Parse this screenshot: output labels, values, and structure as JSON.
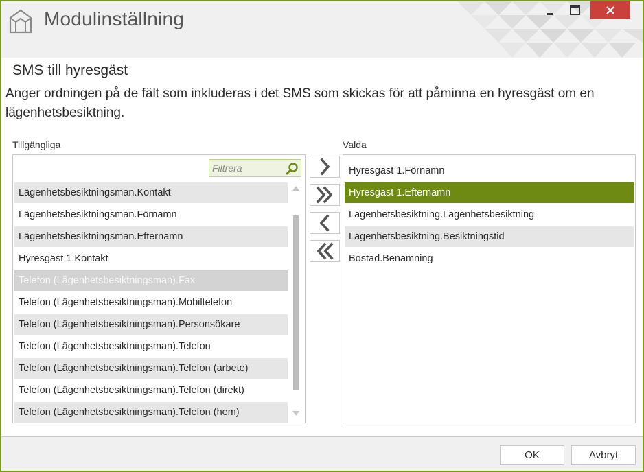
{
  "window": {
    "title": "Modulinställning"
  },
  "section": {
    "title": "SMS till hyresgäst",
    "description": "Anger ordningen på de fält som inkluderas i det SMS som skickas för att påminna en hyresgäst om en lägenhetsbesiktning."
  },
  "available": {
    "label": "Tillgängliga",
    "filter_placeholder": "Filtrera",
    "items": [
      "Lägenhetsbesiktningsman.Kontakt",
      "Lägenhetsbesiktningsman.Förnamn",
      "Lägenhetsbesiktningsman.Efternamn",
      "Hyresgäst 1.Kontakt",
      "Telefon (Lägenhetsbesiktningsman).Fax",
      "Telefon (Lägenhetsbesiktningsman).Mobiltelefon",
      "Telefon (Lägenhetsbesiktningsman).Personsökare",
      "Telefon (Lägenhetsbesiktningsman).Telefon",
      "Telefon (Lägenhetsbesiktningsman).Telefon (arbete)",
      "Telefon (Lägenhetsbesiktningsman).Telefon (direkt)",
      "Telefon (Lägenhetsbesiktningsman).Telefon (hem)"
    ]
  },
  "selected": {
    "label": "Valda",
    "items": [
      "Hyresgäst 1.Förnamn",
      "Hyresgäst 1.Efternamn",
      "Lägenhetsbesiktning.Lägenhetsbesiktning",
      "Lägenhetsbesiktning.Besiktningstid",
      "Bostad.Benämning"
    ]
  },
  "buttons": {
    "ok": "OK",
    "cancel": "Avbryt"
  },
  "colors": {
    "accent": "#6e8a12",
    "frame": "#7a9a1e",
    "close": "#c9413a"
  }
}
